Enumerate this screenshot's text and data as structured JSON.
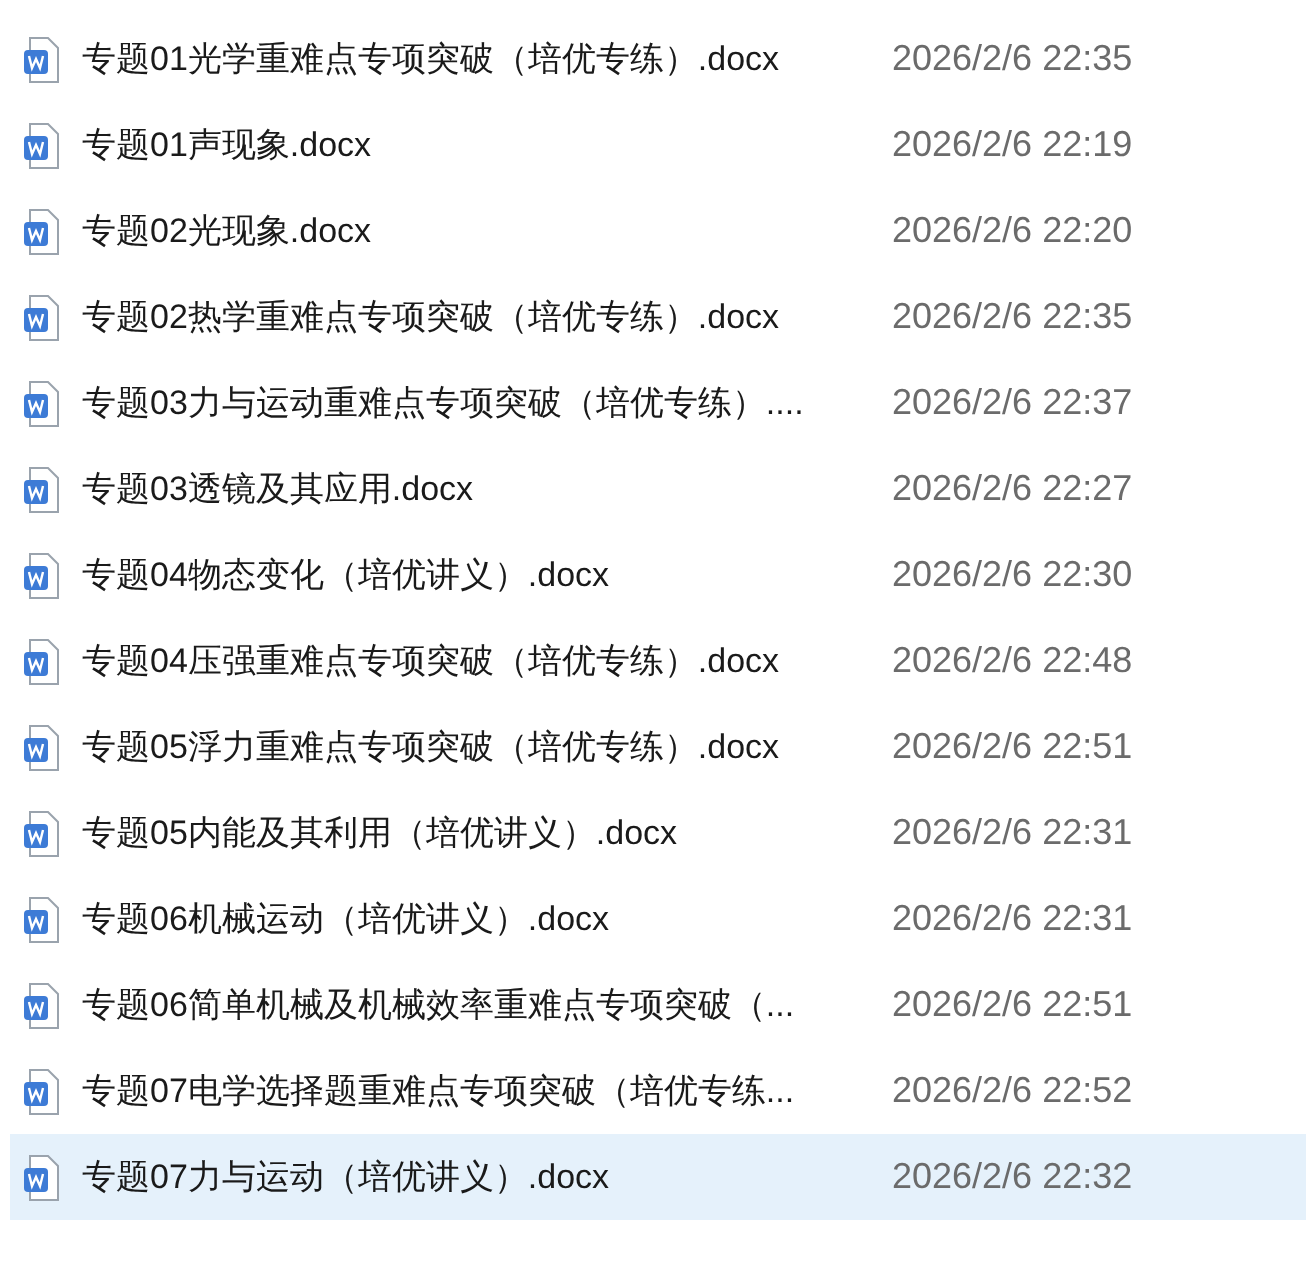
{
  "files": [
    {
      "name": "专题01光学重难点专项突破（培优专练）.docx",
      "modified": "2026/2/6 22:35",
      "selected": false
    },
    {
      "name": "专题01声现象.docx",
      "modified": "2026/2/6 22:19",
      "selected": false
    },
    {
      "name": "专题02光现象.docx",
      "modified": "2026/2/6 22:20",
      "selected": false
    },
    {
      "name": "专题02热学重难点专项突破（培优专练）.docx",
      "modified": "2026/2/6 22:35",
      "selected": false
    },
    {
      "name": "专题03力与运动重难点专项突破（培优专练）....",
      "modified": "2026/2/6 22:37",
      "selected": false
    },
    {
      "name": "专题03透镜及其应用.docx",
      "modified": "2026/2/6 22:27",
      "selected": false
    },
    {
      "name": "专题04物态变化（培优讲义）.docx",
      "modified": "2026/2/6 22:30",
      "selected": false
    },
    {
      "name": "专题04压强重难点专项突破（培优专练）.docx",
      "modified": "2026/2/6 22:48",
      "selected": false
    },
    {
      "name": "专题05浮力重难点专项突破（培优专练）.docx",
      "modified": "2026/2/6 22:51",
      "selected": false
    },
    {
      "name": "专题05内能及其利用（培优讲义）.docx",
      "modified": "2026/2/6 22:31",
      "selected": false
    },
    {
      "name": "专题06机械运动（培优讲义）.docx",
      "modified": "2026/2/6 22:31",
      "selected": false
    },
    {
      "name": "专题06简单机械及机械效率重难点专项突破（...",
      "modified": "2026/2/6 22:51",
      "selected": false
    },
    {
      "name": "专题07电学选择题重难点专项突破（培优专练...",
      "modified": "2026/2/6 22:52",
      "selected": false
    },
    {
      "name": "专题07力与运动（培优讲义）.docx",
      "modified": "2026/2/6 22:32",
      "selected": true
    }
  ]
}
